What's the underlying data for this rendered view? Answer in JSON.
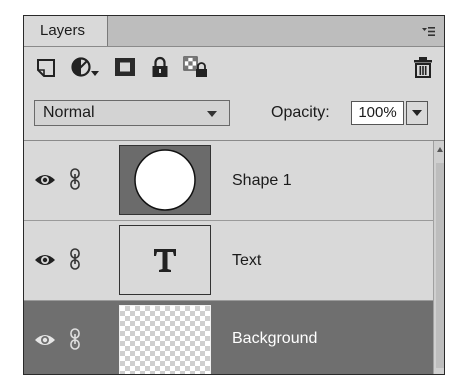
{
  "panel": {
    "tab_label": "Layers",
    "menu_icon": "panel-menu-icon"
  },
  "toolbar": {
    "icons": [
      "new-layer-icon",
      "adjustment-layer-icon",
      "layer-mask-icon",
      "lock-all-icon",
      "lock-transparency-icon",
      "trash-icon"
    ]
  },
  "options": {
    "blend_mode": "Normal",
    "opacity_label": "Opacity:",
    "opacity_value": "100%"
  },
  "layers": [
    {
      "name": "Shape 1",
      "selected": false,
      "thumbnail": "white-circle"
    },
    {
      "name": "Text",
      "selected": false,
      "thumbnail": "type-T"
    },
    {
      "name": "Background",
      "selected": true,
      "thumbnail": "transparent-checkerboard"
    }
  ],
  "colors": {
    "panel_bg": "#d9d9d9",
    "selected_row_bg": "#6f6f6f",
    "selected_row_text": "#ffffff"
  }
}
